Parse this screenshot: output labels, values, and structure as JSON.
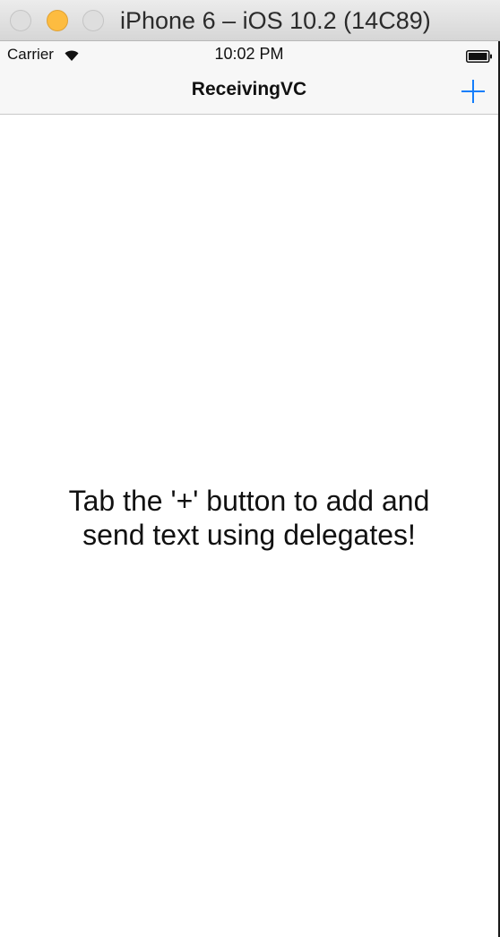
{
  "window": {
    "title": "iPhone 6 – iOS 10.2 (14C89)"
  },
  "status_bar": {
    "carrier": "Carrier",
    "time": "10:02 PM",
    "wifi_icon": "wifi-icon",
    "battery_icon": "battery-icon"
  },
  "nav_bar": {
    "title": "ReceivingVC",
    "add_button_icon": "plus-icon"
  },
  "content": {
    "line1": "Tab the '+' button to add and",
    "line2": "send text using delegates!"
  },
  "colors": {
    "tint": "#147efb",
    "minimize_button": "#fdbc40"
  }
}
